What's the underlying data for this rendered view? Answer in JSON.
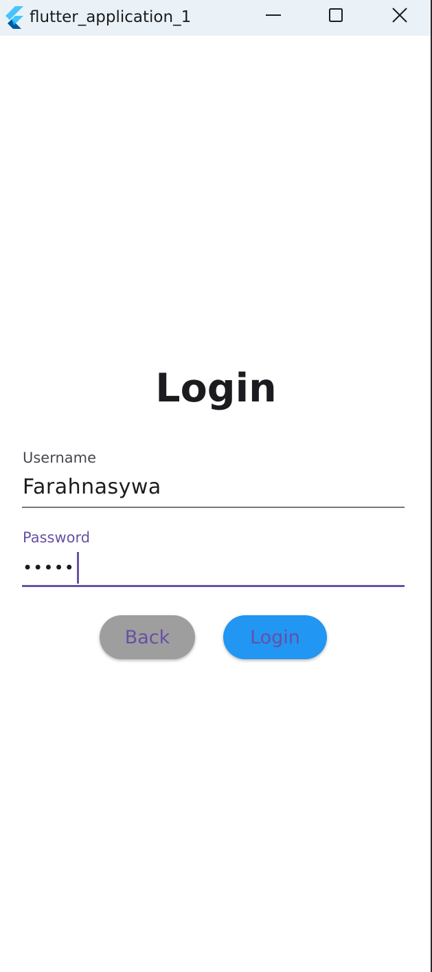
{
  "window": {
    "title": "flutter_application_1",
    "icon": "flutter-logo-icon",
    "controls": {
      "minimize_icon": "minimize-icon",
      "maximize_icon": "maximize-icon",
      "close_icon": "close-icon"
    }
  },
  "login": {
    "heading": "Login",
    "username": {
      "label": "Username",
      "value": "Farahnasywa"
    },
    "password": {
      "label": "Password",
      "value": "•••••"
    },
    "buttons": {
      "back_label": "Back",
      "login_label": "Login"
    }
  },
  "colors": {
    "primary": "#6750a4",
    "back_button": "#9e9e9e",
    "login_button": "#2196f3",
    "titlebar": "#eaf2f8"
  }
}
